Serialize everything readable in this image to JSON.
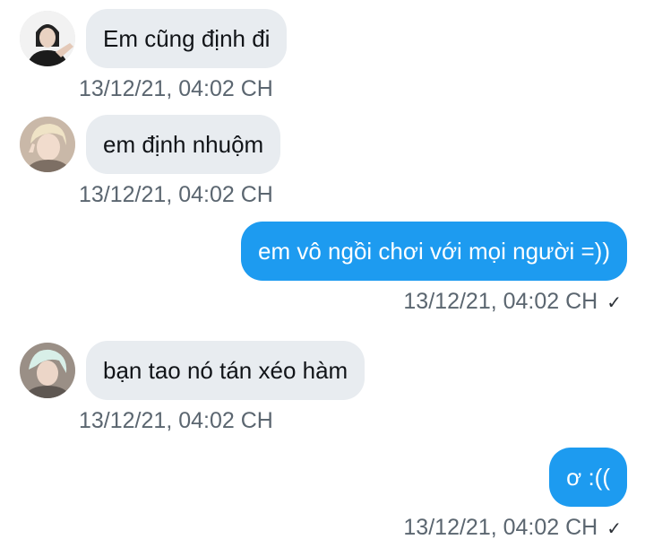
{
  "messages": [
    {
      "direction": "incoming",
      "text": "Em cũng định đi",
      "time": "13/12/21, 04:02 CH",
      "avatar": "avatar-1"
    },
    {
      "direction": "incoming",
      "text": "em định nhuộm",
      "time": "13/12/21, 04:02 CH",
      "avatar": "avatar-2"
    },
    {
      "direction": "outgoing",
      "text": "em vô ngồi chơi với mọi người =))",
      "time": "13/12/21, 04:02 CH",
      "read_icon": "check-icon"
    },
    {
      "direction": "incoming",
      "text": "bạn tao nó tán xéo hàm",
      "time": "13/12/21, 04:02 CH",
      "avatar": "avatar-3"
    },
    {
      "direction": "outgoing",
      "text": "ơ :((",
      "time": "13/12/21, 04:02 CH",
      "read_icon": "check-icon"
    }
  ],
  "check_glyph": "✓",
  "colors": {
    "incoming_bubble": "#e8ecf0",
    "outgoing_bubble": "#1d9bf0",
    "timestamp": "#5b6670"
  }
}
